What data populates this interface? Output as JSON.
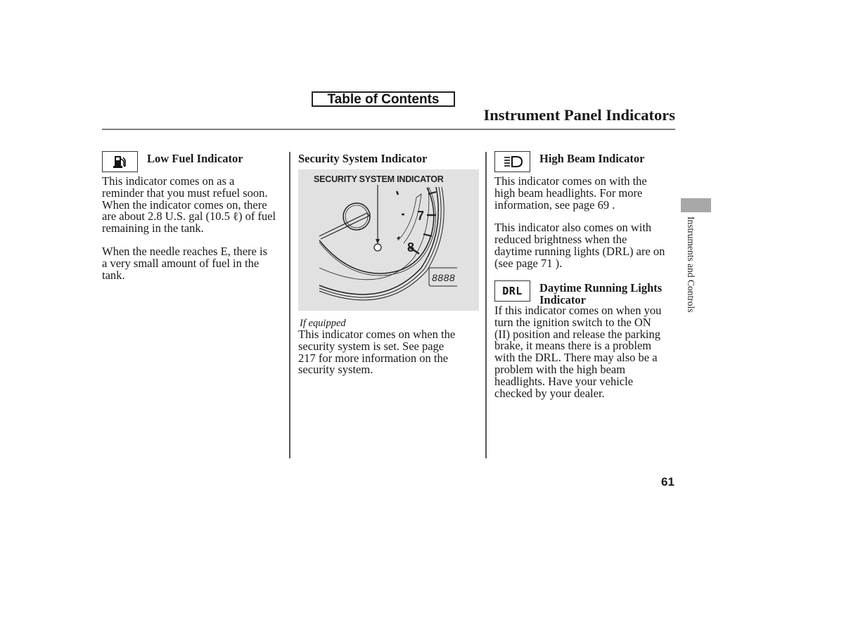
{
  "header": {
    "toc_button": "Table of Contents",
    "page_title": "Instrument Panel Indicators"
  },
  "columns": {
    "low_fuel": {
      "icon": "fuel-pump-icon",
      "heading": "Low Fuel Indicator",
      "paragraphs": [
        "This indicator comes on as a\nreminder that you must refuel soon.\nWhen the indicator comes on, there\nare about 2.8 U.S. gal (10.5 ℓ) of fuel\nremaining in the tank.",
        "When the needle reaches E, there is\na very small amount of fuel in the\ntank."
      ]
    },
    "security": {
      "heading": "Security System Indicator",
      "figure": {
        "label": "SECURITY SYSTEM INDICATOR",
        "tach_numbers": [
          "7",
          "8"
        ],
        "odometer_display": "8888"
      },
      "note": "If equipped",
      "paragraphs": [
        "This indicator comes on when the\nsecurity system is set. See page\n 217 for more information on the\nsecurity system."
      ]
    },
    "high_beam": {
      "icon": "high-beam-icon",
      "heading": "High Beam Indicator",
      "paragraphs": [
        "This indicator comes on with the\nhigh beam headlights. For more\ninformation, see page  69  .",
        "This indicator also comes on with\nreduced brightness when the\ndaytime running lights (DRL) are on\n(see page  71  )."
      ]
    },
    "drl": {
      "icon_text": "DRL",
      "heading_line1": "Daytime Running Lights",
      "heading_line2": "Indicator",
      "paragraphs": [
        "If this indicator comes on when you\nturn the ignition switch to the ON\n(II) position and release the parking\nbrake, it means there is a problem\nwith the DRL. There may also be a\nproblem with the high beam\nheadlights. Have your vehicle\nchecked by your dealer."
      ]
    }
  },
  "side_tab": {
    "label": "Instruments and Controls"
  },
  "footer": {
    "page_number": "61"
  }
}
